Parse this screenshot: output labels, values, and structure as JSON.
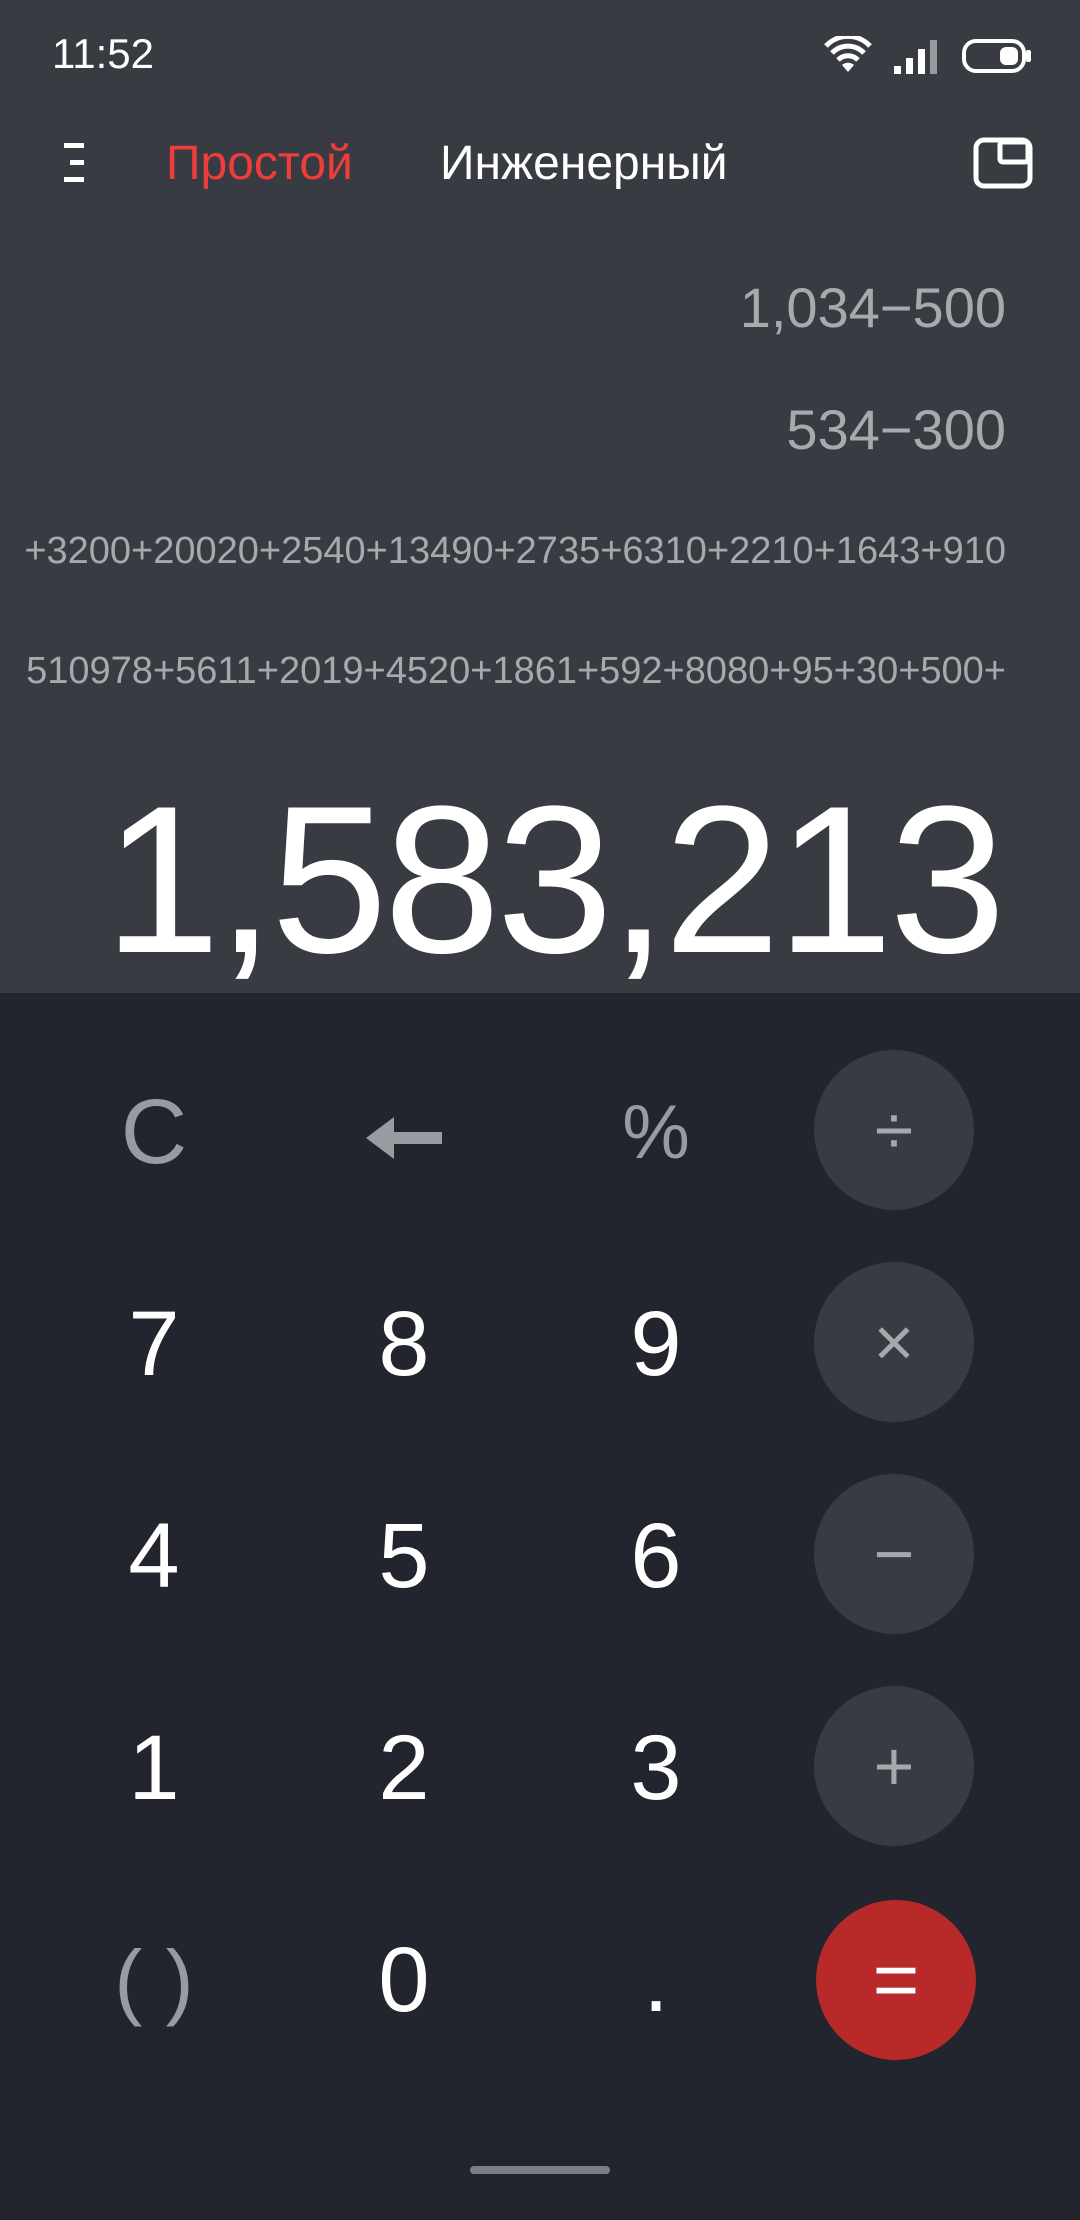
{
  "status_bar": {
    "time": "11:52",
    "icons": [
      "wifi-icon",
      "signal-icon",
      "battery-icon"
    ]
  },
  "app_bar": {
    "menu_icon": "menu-icon",
    "tabs": [
      {
        "label": "Простой",
        "active": true
      },
      {
        "label": "Инженерный",
        "active": false
      }
    ],
    "window_icon": "floating-window-icon"
  },
  "history": [
    "1,034−500",
    "534−300",
    "+3200+20020+2540+13490+2735+6310+2210+1643+910",
    "510978+5611+2019+4520+1861+592+8080+95+30+500+"
  ],
  "result": "1,583,213",
  "keypad": {
    "row1": [
      "C",
      "",
      "%",
      "÷"
    ],
    "row2": [
      "7",
      "8",
      "9",
      "×"
    ],
    "row3": [
      "4",
      "5",
      "6",
      "−"
    ],
    "row4": [
      "1",
      "2",
      "3",
      "+"
    ],
    "row5": [
      "( )",
      "0",
      ".",
      "="
    ]
  },
  "colors": {
    "accent_red": "#ee3d3b",
    "equals_button": "#b82a2a",
    "display_bg": "#393b43",
    "keypad_bg": "#22242e"
  }
}
